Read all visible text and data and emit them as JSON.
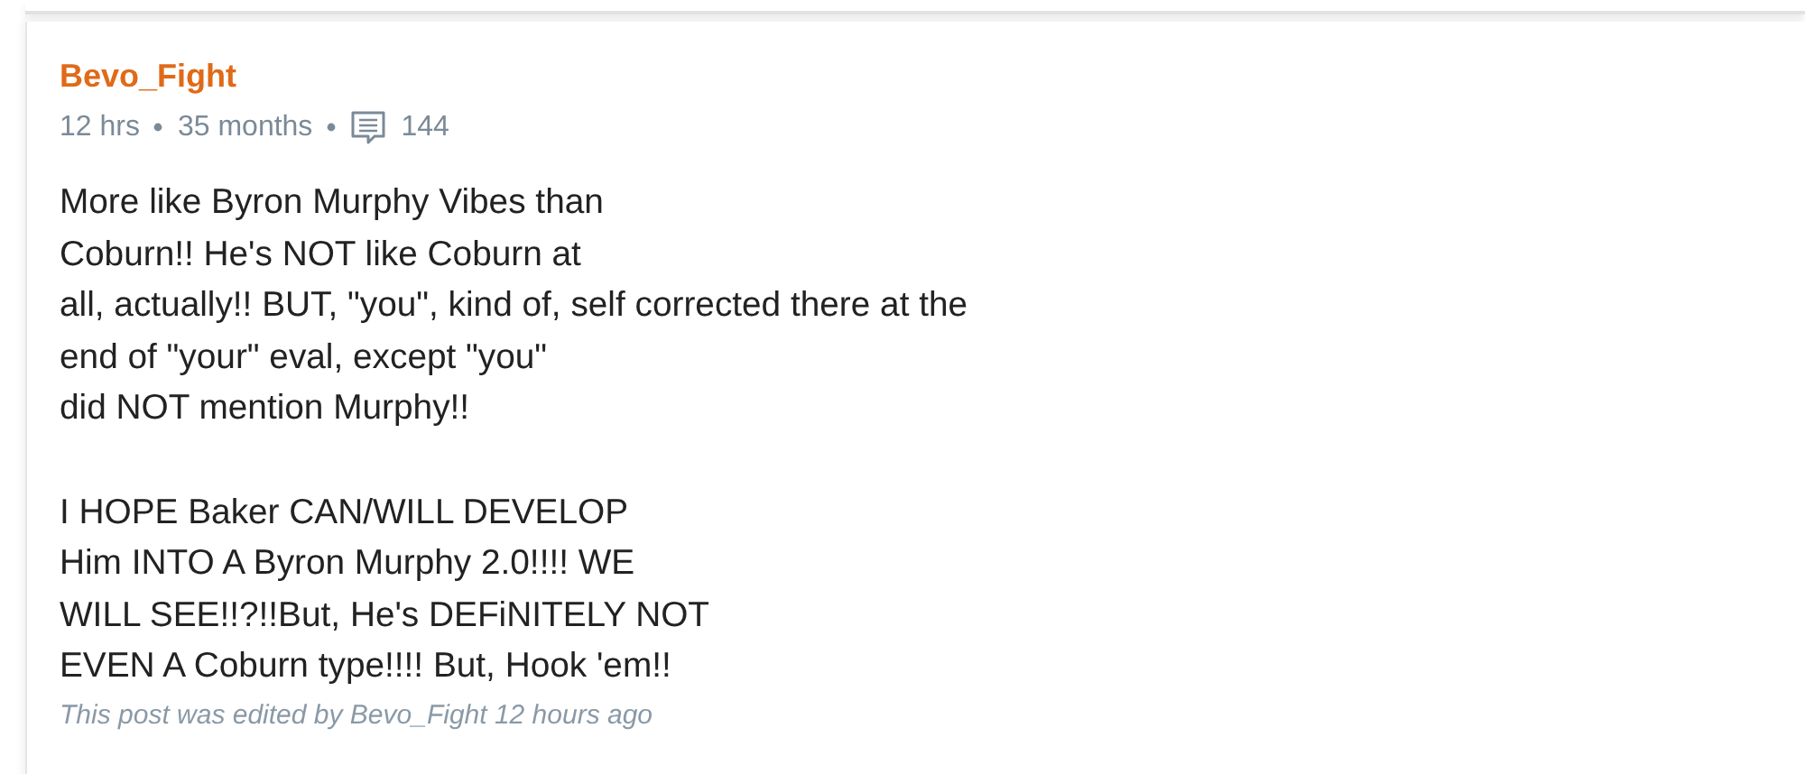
{
  "post": {
    "author": "Bevo_Fight",
    "meta": {
      "posted": "12 hrs",
      "membership": "35 months",
      "comment_count": "144"
    },
    "paragraphs": [
      [
        "More like Byron Murphy Vibes than",
        "Coburn!! He's NOT like Coburn at",
        "all, actually!! BUT, \"you\", kind of, self corrected there at the",
        "end of \"your\" eval, except \"you\"",
        "did NOT mention Murphy!!"
      ],
      [
        "I HOPE Baker CAN/WILL DEVELOP",
        "Him INTO A Byron Murphy 2.0!!!! WE",
        "WILL SEE!!?!!But, He's DEFiNITELY NOT",
        "EVEN A Coburn type!!!! But, Hook 'em!!"
      ]
    ],
    "edit_note": "This post was edited by Bevo_Fight 12 hours ago"
  }
}
